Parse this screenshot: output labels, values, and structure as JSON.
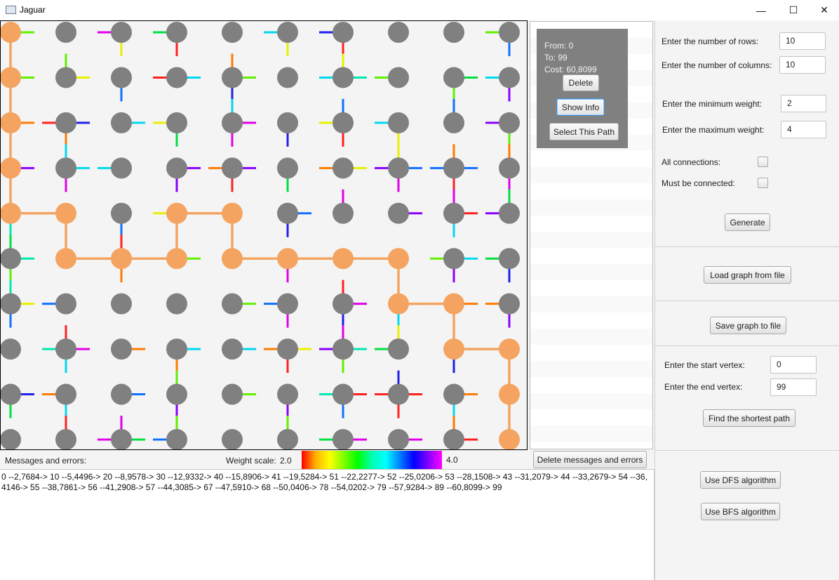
{
  "window": {
    "title": "Jaguar",
    "controls": {
      "minimize": "—",
      "maximize": "☐",
      "close": "✕"
    }
  },
  "graph": {
    "rows": 10,
    "cols": 10,
    "node_color": "#808080",
    "path_color": "#f4a460",
    "path_vertices": [
      0,
      10,
      20,
      30,
      40,
      41,
      51,
      52,
      53,
      43,
      44,
      54,
      55,
      56,
      57,
      67,
      68,
      78,
      79,
      89,
      99
    ]
  },
  "path_card": {
    "from": "From: 0",
    "to": "To: 99",
    "cost": "Cost: 60,8099",
    "delete_label": "Delete",
    "show_info_label": "Show Info",
    "select_label": "Select This Path"
  },
  "settings": {
    "rows_label": "Enter the number of rows:",
    "rows_value": "10",
    "cols_label": "Enter the number of columns:",
    "cols_value": "10",
    "min_weight_label": "Enter the minimum weight:",
    "min_weight_value": "2",
    "max_weight_label": "Enter the maximum weight:",
    "max_weight_value": "4",
    "all_connections_label": "All connections:",
    "must_be_connected_label": "Must be connected:",
    "generate_label": "Generate",
    "load_label": "Load graph from file",
    "save_label": "Save graph to file",
    "start_label": "Enter the start vertex:",
    "start_value": "0",
    "end_label": "Enter the end vertex:",
    "end_value": "99",
    "find_label": "Find the shortest path",
    "dfs_label": "Use DFS algorithm",
    "bfs_label": "Use BFS algorithm"
  },
  "bottom": {
    "messages_label": "Messages and errors:",
    "weight_scale_label": "Weight scale:",
    "weight_min": "2.0",
    "weight_max": "4.0",
    "delete_messages_label": "Delete messages and errors"
  },
  "messages": {
    "text": "0 --2,7684-> 10 --5,4496-> 20 --8,9578-> 30 --12,9332-> 40 --15,8906-> 41 --19,5284-> 51 --22,2277-> 52 --25,0206-> 53 --28,1508-> 43 --31,2079-> 44 --33,2679-> 54 --36,4146-> 55 --38,7861-> 56 --41,2908-> 57 --44,3085-> 67 --47,5910-> 68 --50,0406-> 78 --54,0202-> 79 --57,9284-> 89 --60,8099-> 99"
  }
}
